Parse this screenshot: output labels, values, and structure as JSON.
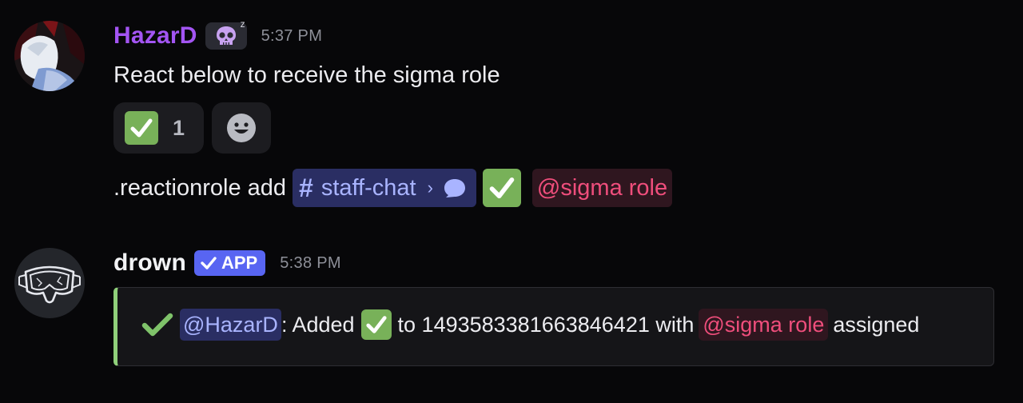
{
  "messages": [
    {
      "username": "HazarD",
      "username_color": "#a355f3",
      "badge_icon": "skull-emoji",
      "badge_extra": "z",
      "timestamp": "5:37 PM",
      "text": "React below to receive the sigma role",
      "reactions": [
        {
          "emoji": "white-check-mark",
          "count": "1"
        },
        {
          "emoji": "add-reaction-smiley"
        }
      ],
      "command": {
        "prefix": ".reactionrole add",
        "channel_hash": "#",
        "channel": "staff-chat",
        "channel_chevron": "›",
        "role": "@sigma role"
      }
    },
    {
      "username": "drown",
      "username_color": "#f2f3f5",
      "app_badge": "APP",
      "timestamp": "5:38 PM",
      "embed": {
        "accent": "#8fd07a",
        "mention": "@HazarD",
        "added": ": Added",
        "target": "to 1493583381663846421 with",
        "role": "@sigma role",
        "suffix": "assigned"
      }
    }
  ]
}
